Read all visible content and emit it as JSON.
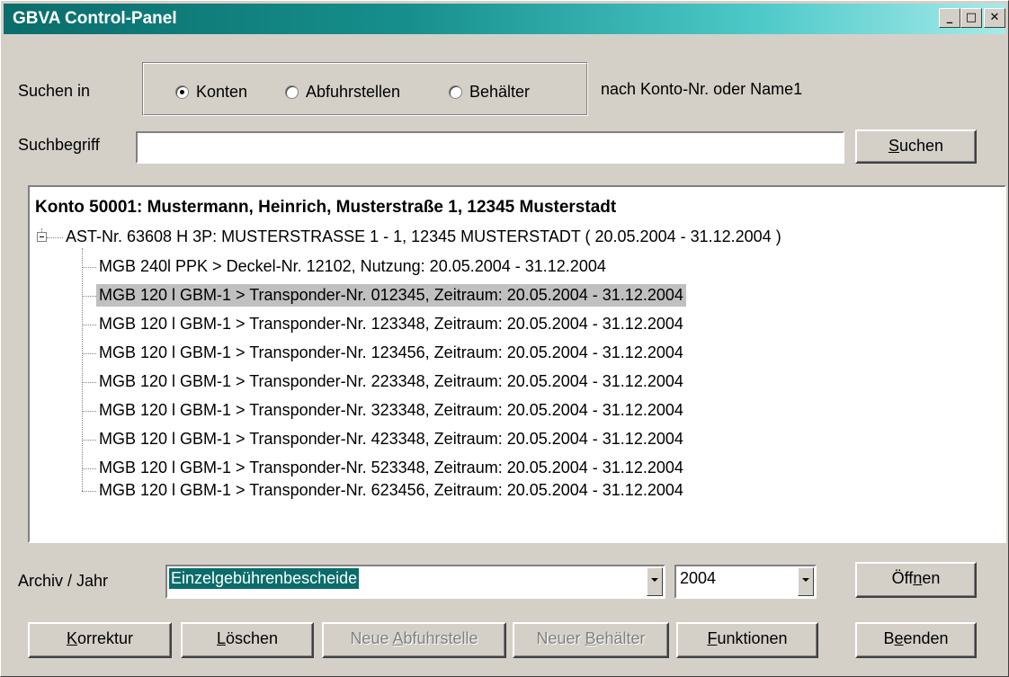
{
  "window": {
    "title": "GBVA Control-Panel",
    "minimize": "_",
    "maximize": "□",
    "close": "✕",
    "colors": {
      "titlebar_start": "#0a6d6b",
      "titlebar_end": "#a6eaea",
      "face": "#d4d0c8",
      "selection": "#c0c0c0",
      "highlight": "#0a6d6b"
    }
  },
  "search": {
    "label_in": "Suchen in",
    "options": [
      {
        "label": "Konten",
        "checked": true
      },
      {
        "label": "Abfuhrstellen",
        "checked": false
      },
      {
        "label": "Behälter",
        "checked": false
      }
    ],
    "hint": "nach Konto-Nr. oder Name1",
    "term_label": "Suchbegriff",
    "term_value": "",
    "button": {
      "pre": "",
      "accel": "S",
      "post": "uchen"
    }
  },
  "tree": {
    "root": "Konto 50001: Mustermann, Heinrich, Musterstraße 1, 12345 Musterstadt",
    "ast": "AST-Nr. 63608 H 3P: MUSTERSTRASSE 1 - 1, 12345 MUSTERSTADT ( 20.05.2004 - 31.12.2004 )",
    "items": [
      "MGB   240l PPK > Deckel-Nr. 12102, Nutzung: 20.05.2004 - 31.12.2004",
      "MGB 120 l GBM-1 > Transponder-Nr. 012345, Zeitraum: 20.05.2004 - 31.12.2004",
      "MGB 120 l GBM-1 > Transponder-Nr. 123348, Zeitraum: 20.05.2004 - 31.12.2004",
      "MGB 120 l GBM-1 > Transponder-Nr. 123456, Zeitraum: 20.05.2004 - 31.12.2004",
      "MGB 120 l GBM-1 > Transponder-Nr. 223348, Zeitraum: 20.05.2004 - 31.12.2004",
      "MGB 120 l GBM-1 > Transponder-Nr. 323348, Zeitraum: 20.05.2004 - 31.12.2004",
      "MGB 120 l GBM-1 > Transponder-Nr. 423348, Zeitraum: 20.05.2004 - 31.12.2004",
      "MGB 120 l GBM-1 > Transponder-Nr. 523348, Zeitraum: 20.05.2004 - 31.12.2004",
      "MGB 120 l GBM-1 > Transponder-Nr. 623456, Zeitraum: 20.05.2004 - 31.12.2004"
    ],
    "selected_index": 1
  },
  "archive": {
    "label": "Archiv / Jahr",
    "selected": "Einzelgebührenbescheide",
    "year": "2004",
    "open_button": {
      "pre": "Öff",
      "accel": "n",
      "post": "en"
    }
  },
  "buttons": {
    "korrektur": {
      "pre": "",
      "accel": "K",
      "post": "orrektur",
      "disabled": false
    },
    "loeschen": {
      "pre": "",
      "accel": "L",
      "post": "öschen",
      "disabled": false
    },
    "neue_abfuhrstelle": {
      "pre": "Neue ",
      "accel": "A",
      "post": "bfuhrstelle",
      "disabled": true
    },
    "neuer_behaelter": {
      "pre": "Neuer ",
      "accel": "B",
      "post": "ehälter",
      "disabled": true
    },
    "funktionen": {
      "pre": "",
      "accel": "F",
      "post": "unktionen",
      "disabled": false
    },
    "beenden": {
      "pre": "B",
      "accel": "e",
      "post": "enden",
      "disabled": false
    }
  }
}
